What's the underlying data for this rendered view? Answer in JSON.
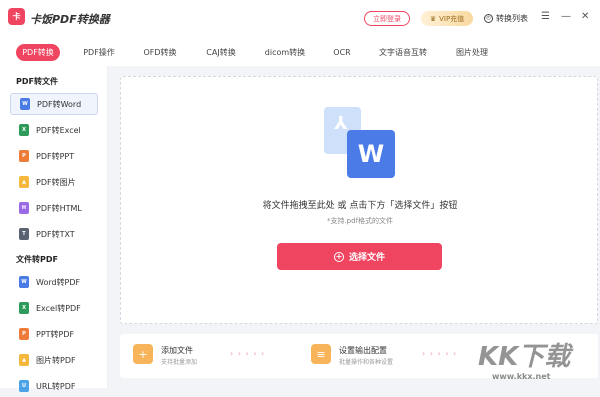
{
  "header": {
    "logo_icon": "卡",
    "app_title": "卡饭PDF转换器",
    "login_label": "立即登录",
    "vip_icon": "crown-icon",
    "vip_label": "VIP充值",
    "conv_list_label": "转换列表",
    "menu_icon": "☰",
    "minimize_icon": "—",
    "close_icon": "✕",
    "accent": "#ef4560"
  },
  "tabs": [
    {
      "label": "PDF转换"
    },
    {
      "label": "PDF操作"
    },
    {
      "label": "OFD转换"
    },
    {
      "label": "CAJ转换"
    },
    {
      "label": "dicom转换"
    },
    {
      "label": "OCR"
    },
    {
      "label": "文字语音互转"
    },
    {
      "label": "图片处理"
    }
  ],
  "sidebar": {
    "section1_title": "PDF转文件",
    "section2_title": "文件转PDF",
    "items1": [
      {
        "label": "PDF转Word",
        "icon": "W",
        "color": "#4a7be6"
      },
      {
        "label": "PDF转Excel",
        "icon": "X",
        "color": "#2e9b5a"
      },
      {
        "label": "PDF转PPT",
        "icon": "P",
        "color": "#ef7b3a"
      },
      {
        "label": "PDF转图片",
        "icon": "▲",
        "color": "#f5b83d"
      },
      {
        "label": "PDF转HTML",
        "icon": "H",
        "color": "#9b6be6"
      },
      {
        "label": "PDF转TXT",
        "icon": "T",
        "color": "#5a6170"
      }
    ],
    "items2": [
      {
        "label": "Word转PDF",
        "icon": "W",
        "color": "#4a7be6"
      },
      {
        "label": "Excel转PDF",
        "icon": "X",
        "color": "#2e9b5a"
      },
      {
        "label": "PPT转PDF",
        "icon": "P",
        "color": "#ef7b3a"
      },
      {
        "label": "图片转PDF",
        "icon": "▲",
        "color": "#f5b83d"
      },
      {
        "label": "URL转PDF",
        "icon": "U",
        "color": "#4aa3e6"
      }
    ]
  },
  "main": {
    "icon_back": "pdf-file-icon",
    "icon_front": "W",
    "drop_text": "将文件拖拽至此处 或 点击下方「选择文件」按钮",
    "drop_sub": "*支持.pdf格式的文件",
    "select_label": "选择文件",
    "plus": "+"
  },
  "bottom": {
    "add_title": "添加文件",
    "add_sub": "支持批量添加",
    "settings_title": "设置输出配置",
    "settings_sub": "批量操作和各种设置",
    "arrows": "› › › › ›"
  },
  "watermark": {
    "text": "KK下载",
    "url": "www.kkx.net"
  }
}
